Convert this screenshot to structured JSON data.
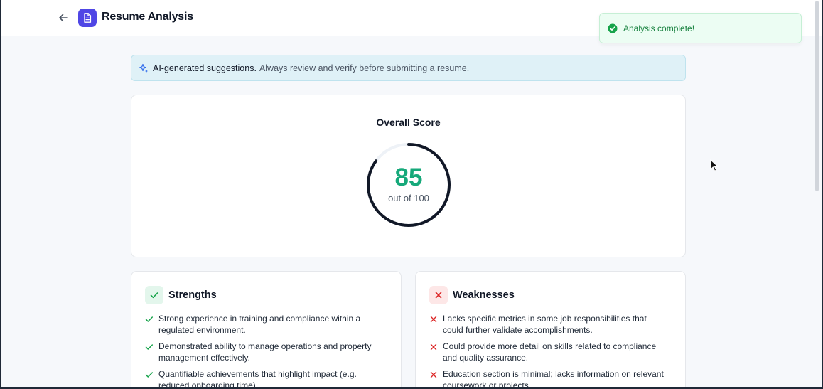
{
  "header": {
    "title": "Resume Analysis",
    "back_icon": "arrow-left-icon",
    "logo_icon": "document-icon",
    "logo_color": "#4f46e5"
  },
  "toast": {
    "message": "Analysis complete!",
    "icon": "check-circle-icon",
    "color": "#16a34a"
  },
  "banner": {
    "icon": "sparkles-icon",
    "strong": "AI-generated suggestions.",
    "text": "Always review and verify before submitting a resume."
  },
  "score": {
    "title": "Overall Score",
    "value": "85",
    "subtitle": "out of 100",
    "fraction": 0.85,
    "value_color": "#16a97a",
    "ring_color": "#111827"
  },
  "strengths": {
    "title": "Strengths",
    "icon": "check-icon",
    "items": [
      "Strong experience in training and compliance within a regulated environment.",
      "Demonstrated ability to manage operations and property management effectively.",
      "Quantifiable achievements that highlight impact (e.g. reduced onboarding time)."
    ]
  },
  "weaknesses": {
    "title": "Weaknesses",
    "icon": "x-icon",
    "items": [
      "Lacks specific metrics in some job responsibilities that could further validate accomplishments.",
      "Could provide more detail on skills related to compliance and quality assurance.",
      "Education section is minimal; lacks information on relevant coursework or projects."
    ]
  }
}
